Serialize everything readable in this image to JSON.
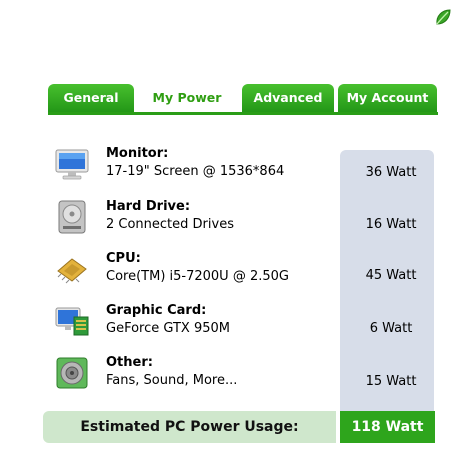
{
  "tabs": [
    {
      "label": "General"
    },
    {
      "label": "My Power"
    },
    {
      "label": "Advanced"
    },
    {
      "label": "My Account"
    }
  ],
  "active_tab": "My Power",
  "components": [
    {
      "title": "Monitor:",
      "detail": "17-19\" Screen @ 1536*864",
      "watt": "36 Watt",
      "icon": "monitor-icon"
    },
    {
      "title": "Hard Drive:",
      "detail": "2 Connected Drives",
      "watt": "16 Watt",
      "icon": "hard-drive-icon"
    },
    {
      "title": "CPU:",
      "detail": "Core(TM) i5-7200U  @ 2.50G",
      "watt": "45 Watt",
      "icon": "cpu-icon"
    },
    {
      "title": "Graphic Card:",
      "detail": "GeForce GTX 950M",
      "watt": "6 Watt",
      "icon": "graphic-card-icon"
    },
    {
      "title": "Other:",
      "detail": "Fans, Sound, More...",
      "watt": "15 Watt",
      "icon": "speaker-icon"
    }
  ],
  "total": {
    "label": "Estimated PC Power Usage:",
    "value": "118 Watt"
  },
  "colors": {
    "accent": "#2a9d17",
    "watt_column": "#d7dde9",
    "total_label_bg": "#cfe7cc"
  }
}
